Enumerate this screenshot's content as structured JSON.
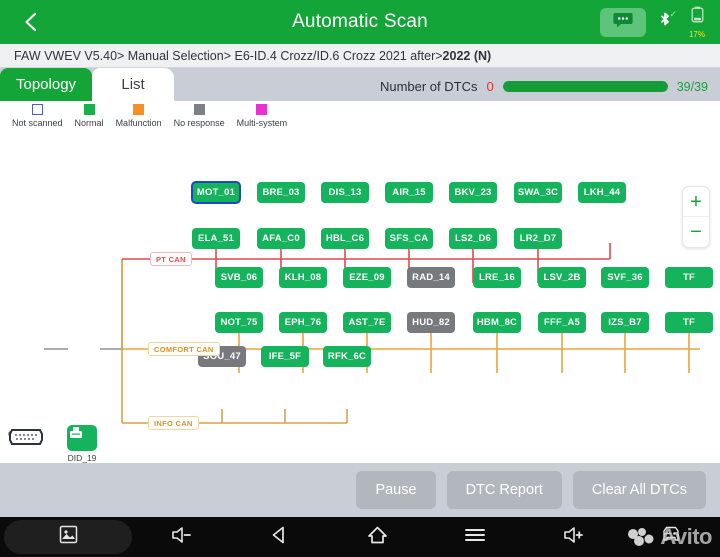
{
  "header": {
    "title": "Automatic Scan",
    "back_icon": "chevron-left-icon",
    "chat_icon": "chat-bubble-icon",
    "bluetooth_icon": "bluetooth-icon",
    "battery_icon": "battery-icon",
    "battery_percent": "17%",
    "accent_color": "#13a538"
  },
  "breadcrumb": {
    "path": "FAW VWEV V5.40> Manual Selection> E6-ID.4 Crozz/ID.6 Crozz 2021 after> ",
    "current": "2022 (N)"
  },
  "tabs": [
    {
      "label": "Topology",
      "active": true
    },
    {
      "label": "List",
      "active": false
    }
  ],
  "dtc": {
    "label": "Number of DTCs",
    "count": "0",
    "count_color": "#e8342b",
    "progress_percent": 100,
    "progress_text": "39/39",
    "progress_color": "#159b37"
  },
  "legend": [
    {
      "label": "Not scanned",
      "color": "#ffffff",
      "key": "notscanned"
    },
    {
      "label": "Normal",
      "color": "#17b04a",
      "key": "normal"
    },
    {
      "label": "Malfunction",
      "color": "#f6901e",
      "key": "malfunction"
    },
    {
      "label": "No response",
      "color": "#7d8186",
      "key": "noresponse"
    },
    {
      "label": "Multi-system",
      "color": "#e832cf",
      "key": "multisystem"
    }
  ],
  "topology": {
    "obd_label": "OBD",
    "gateway_label": "DID_19",
    "buses": [
      {
        "name": "PT CAN",
        "color": "#e04a4a"
      },
      {
        "name": "COMFORT CAN",
        "color": "#e8a33c"
      },
      {
        "name": "INFO CAN",
        "color": "#e8a33c"
      }
    ],
    "nodes": {
      "pt_top": [
        "MOT_01",
        "BRE_03",
        "DIS_13",
        "AIR_15",
        "BKV_23",
        "SWA_3C",
        "LKH_44"
      ],
      "pt_bottom": [
        "ELA_51",
        "AFA_C0",
        "HBL_C6",
        "SFS_CA",
        "LS2_D6",
        "LR2_D7"
      ],
      "comfort_top": [
        "SVB_06",
        "KLH_08",
        "EZE_09",
        "RAD_14",
        "LRE_16",
        "LSV_2B",
        "SVF_36",
        "TF"
      ],
      "comfort_bottom": [
        "NOT_75",
        "EPH_76",
        "AST_7E",
        "HUD_82",
        "HBM_8C",
        "FFF_A5",
        "IZS_B7",
        "TF"
      ],
      "info_top": [
        "SOU_47",
        "IFE_5F",
        "RFK_6C"
      ]
    },
    "no_response_nodes": [
      "RAD_14",
      "HUD_82",
      "SOU_47"
    ],
    "selected_node": "MOT_01",
    "zoom_in_label": "+",
    "zoom_out_label": "−"
  },
  "footer": {
    "buttons": [
      "Pause",
      "DTC Report",
      "Clear All DTCs"
    ]
  },
  "navbar": {
    "items": [
      "screenshot-icon",
      "volume-down-icon",
      "back-icon",
      "home-icon",
      "menu-icon",
      "volume-up-icon",
      "car-diagnostic-icon"
    ],
    "watermark": "Avito"
  }
}
